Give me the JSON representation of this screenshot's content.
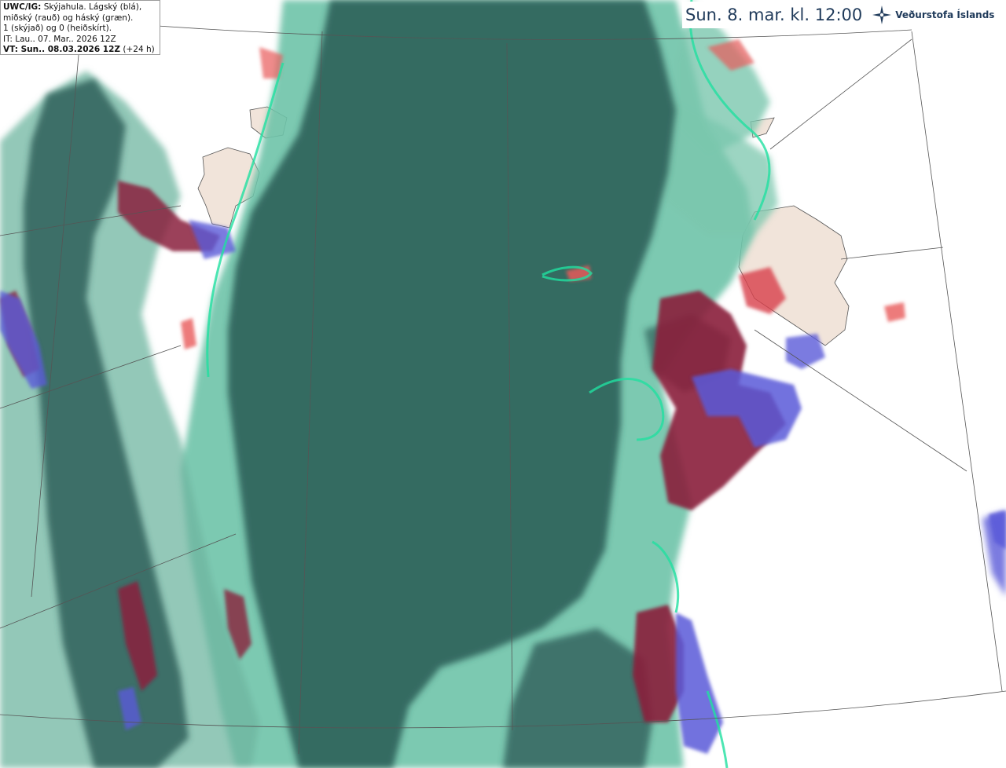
{
  "header": {
    "valid_time_title": "Sun. 8. mar. kl. 12:00",
    "brand": "Veðurstofa Íslands",
    "logo_icon": "vedurstofa-star-icon"
  },
  "info": {
    "product_label": "UWC/IG:",
    "line1_rest": "Skýjahula. Lágský (blá),",
    "line2": "miðský (rauð) og háský (græn).",
    "line3": "1 (skýjað) og 0 (heiðskírt).",
    "line4": "IT: Lau.. 07. Mar.. 2026 12Z",
    "valid_label": "VT: Sun.. 08.03.2026 12Z",
    "lead": "(+24 h)"
  },
  "colors": {
    "low_cloud": "#5a5ad8",
    "mid_cloud": "#8a1f3c",
    "high_cloud": "#6fc3a8",
    "overlap": "#2f5f5a",
    "land": "#f1e4da",
    "contour": "#20e0a0"
  }
}
